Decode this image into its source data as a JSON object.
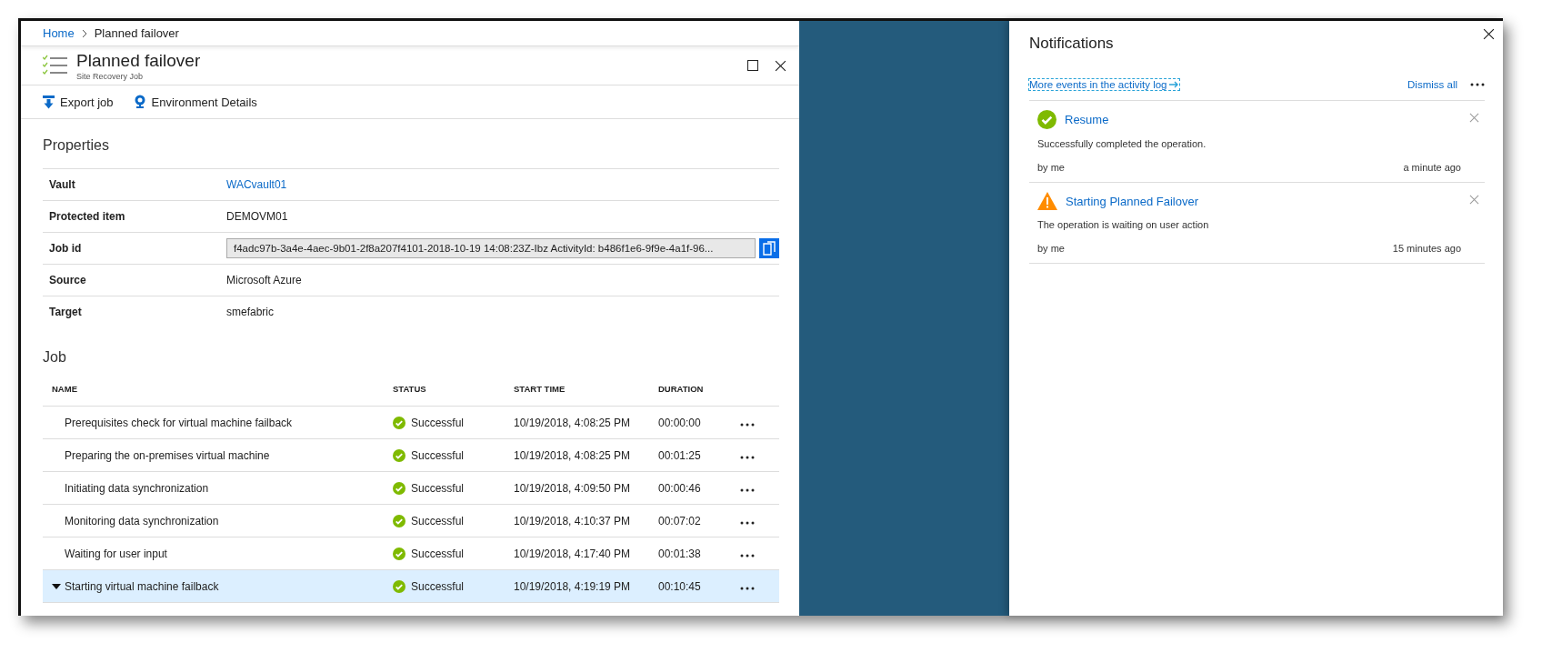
{
  "breadcrumb": [
    {
      "label": "Home",
      "kind": "link"
    },
    {
      "label": "Planned failover",
      "kind": "text"
    }
  ],
  "blade": {
    "title": "Planned failover",
    "subtitle": "Site Recovery Job",
    "toolbar": [
      {
        "label": "Export job",
        "kind": "export"
      },
      {
        "label": "Environment Details",
        "kind": "environment"
      }
    ],
    "properties": {
      "heading": "Properties",
      "rows": [
        {
          "label": "Vault",
          "value": "WACvault01",
          "kind": "link"
        },
        {
          "label": "Protected item",
          "value": "DEMOVM01",
          "kind": "text"
        },
        {
          "label": "Job id",
          "value": "f4adc97b-3a4e-4aec-9b01-2f8a207f4101-2018-10-19 14:08:23Z-Ibz ActivityId: b486f1e6-9f9e-4a1f-96...",
          "kind": "field"
        },
        {
          "label": "Source",
          "value": "Microsoft Azure",
          "kind": "text"
        },
        {
          "label": "Target",
          "value": "smefabric",
          "kind": "text"
        }
      ]
    },
    "job": {
      "heading": "Job",
      "columns": [
        "NAME",
        "STATUS",
        "START TIME",
        "DURATION"
      ],
      "rows": [
        {
          "name": "Prerequisites check for virtual machine failback",
          "status": "Successful",
          "start_time": "10/19/2018, 4:08:25 PM",
          "duration": "00:00:00",
          "expanded": false,
          "selected": false
        },
        {
          "name": "Preparing the on-premises virtual machine",
          "status": "Successful",
          "start_time": "10/19/2018, 4:08:25 PM",
          "duration": "00:01:25",
          "expanded": false,
          "selected": false
        },
        {
          "name": "Initiating data synchronization",
          "status": "Successful",
          "start_time": "10/19/2018, 4:09:50 PM",
          "duration": "00:00:46",
          "expanded": false,
          "selected": false
        },
        {
          "name": "Monitoring data synchronization",
          "status": "Successful",
          "start_time": "10/19/2018, 4:10:37 PM",
          "duration": "00:07:02",
          "expanded": false,
          "selected": false
        },
        {
          "name": "Waiting for user input",
          "status": "Successful",
          "start_time": "10/19/2018, 4:17:40 PM",
          "duration": "00:01:38",
          "expanded": false,
          "selected": false
        },
        {
          "name": "Starting virtual machine failback",
          "status": "Successful",
          "start_time": "10/19/2018, 4:19:19 PM",
          "duration": "00:10:45",
          "expanded": true,
          "selected": true
        }
      ]
    }
  },
  "notifications": {
    "title": "Notifications",
    "activity_link": "More events in the activity log",
    "dismiss_all": "Dismiss all",
    "items": [
      {
        "kind": "success",
        "title": "Resume",
        "message": "Successfully completed the operation.",
        "by": "by me",
        "time": "a minute ago"
      },
      {
        "kind": "warning",
        "title": "Starting Planned Failover",
        "message": "The operation is waiting on user action",
        "by": "by me",
        "time": "15 minutes ago"
      }
    ]
  }
}
